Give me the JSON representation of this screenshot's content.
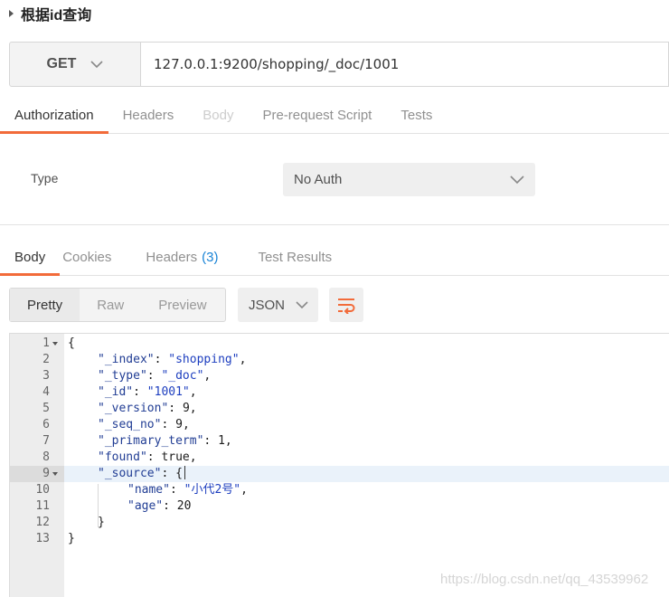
{
  "breadcrumb": {
    "title": "根据id查询"
  },
  "request": {
    "method": "GET",
    "url": "127.0.0.1:9200/shopping/_doc/1001"
  },
  "request_tabs": [
    {
      "label": "Authorization"
    },
    {
      "label": "Headers"
    },
    {
      "label": "Body"
    },
    {
      "label": "Pre-request Script"
    },
    {
      "label": "Tests"
    }
  ],
  "auth": {
    "type_label": "Type",
    "type_value": "No Auth"
  },
  "response_tabs": {
    "body": "Body",
    "cookies": "Cookies",
    "headers": "Headers",
    "headers_count": "(3)",
    "test_results": "Test Results"
  },
  "view_modes": [
    "Pretty",
    "Raw",
    "Preview"
  ],
  "format": "JSON",
  "editor": {
    "lines": [
      {
        "n": "1",
        "text": "{"
      },
      {
        "n": "2",
        "key": "\"_index\"",
        "val": "\"shopping\"",
        "tail": ","
      },
      {
        "n": "3",
        "key": "\"_type\"",
        "val": "\"_doc\"",
        "tail": ","
      },
      {
        "n": "4",
        "key": "\"_id\"",
        "val": "\"1001\"",
        "tail": ","
      },
      {
        "n": "5",
        "key": "\"_version\"",
        "val": "9",
        "tail": ","
      },
      {
        "n": "6",
        "key": "\"_seq_no\"",
        "val": "9",
        "tail": ","
      },
      {
        "n": "7",
        "key": "\"_primary_term\"",
        "val": "1",
        "tail": ","
      },
      {
        "n": "8",
        "key": "\"found\"",
        "val": "true",
        "tail": ","
      },
      {
        "n": "9",
        "key": "\"_source\"",
        "val": "{",
        "tail": ""
      },
      {
        "n": "10",
        "key": "\"name\"",
        "val": "\"小代2号\"",
        "tail": ","
      },
      {
        "n": "11",
        "key": "\"age\"",
        "val": "20",
        "tail": ""
      },
      {
        "n": "12",
        "text": "}"
      },
      {
        "n": "13",
        "text": "}"
      }
    ]
  },
  "watermark": "https://blog.csdn.net/qq_43539962",
  "colors": {
    "accent": "#f26b3a",
    "count": "#1a84d6"
  }
}
